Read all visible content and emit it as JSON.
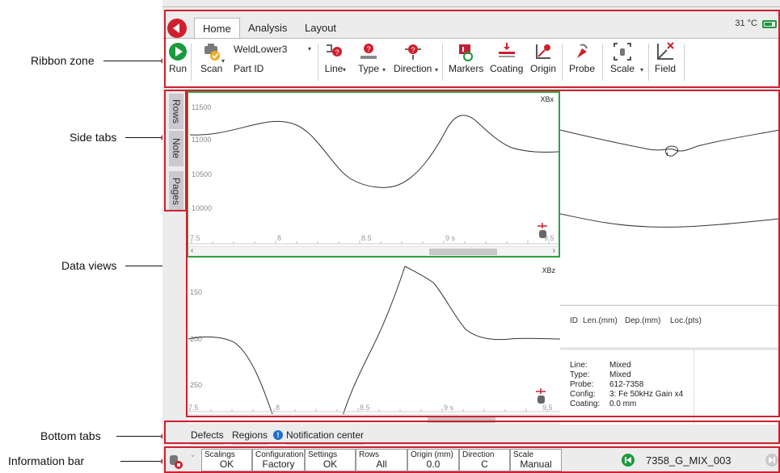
{
  "callouts": {
    "ribbon_zone": "Ribbon zone",
    "side_tabs": "Side tabs",
    "data_views": "Data views",
    "bottom_tabs": "Bottom tabs",
    "information_bar": "Information bar"
  },
  "colors": {
    "accent_red": "#d01f2e",
    "green": "#1a9a3c",
    "view_border": "#2ea43c"
  },
  "tabs": {
    "home": "Home",
    "analysis": "Analysis",
    "layout": "Layout"
  },
  "status": {
    "temperature": "31 °C"
  },
  "ribbon": {
    "run": "Run",
    "scan": "Scan",
    "setup_name": "WeldLower3",
    "part_id": "Part ID",
    "line": "Line",
    "type": "Type",
    "direction": "Direction",
    "markers": "Markers",
    "coating": "Coating",
    "origin": "Origin",
    "probe": "Probe",
    "scale": "Scale",
    "field": "Field"
  },
  "side_tabs": {
    "rows": "Rows",
    "note": "Note",
    "pages": "Pages"
  },
  "views": {
    "top": {
      "label": "XBx",
      "y_ticks": [
        "11500",
        "11000",
        "10500",
        "10000"
      ],
      "x_ticks": [
        "7.5",
        "8",
        "8.5",
        "9 s",
        "9.5"
      ]
    },
    "bottom": {
      "label": "XBz",
      "y_ticks": [
        "150",
        "200",
        "250"
      ],
      "x_ticks": [
        "7.5",
        "8",
        "8.5",
        "9 s",
        "9.5"
      ]
    }
  },
  "defect_table": {
    "id": "ID",
    "len": "Len.(mm)",
    "dep": "Dep.(mm)",
    "loc": "Loc.(pts)"
  },
  "properties": {
    "line_k": "Line:",
    "line_v": "Mixed",
    "type_k": "Type:",
    "type_v": "Mixed",
    "probe_k": "Probe:",
    "probe_v": "612-7358",
    "config_k": "Config:",
    "config_v": "3: Fe 50kHz Gain x4",
    "coating_k": "Coating:",
    "coating_v": "0.0 mm"
  },
  "bottom_tabs": {
    "defects": "Defects",
    "regions": "Regions",
    "notification": "Notification center"
  },
  "info_bar": {
    "scalings_l": "Scalings",
    "scalings_v": "OK",
    "configuration_l": "Configuration",
    "configuration_v": "Factory",
    "settings_l": "Settings",
    "settings_v": "OK",
    "rows_l": "Rows",
    "rows_v": "All",
    "origin_l": "Origin (mm)",
    "origin_v": "0.0",
    "direction_l": "Direction",
    "direction_v": "C",
    "scale_l": "Scale",
    "scale_v": "Manual",
    "file_name": "7358_G_MIX_003"
  }
}
